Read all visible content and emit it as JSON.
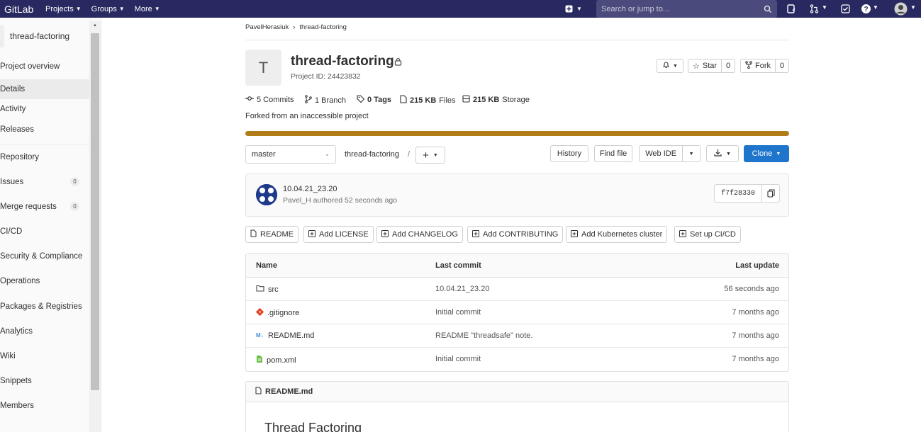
{
  "navbar": {
    "brand": "GitLab",
    "menus": [
      {
        "label": "Projects"
      },
      {
        "label": "Groups"
      },
      {
        "label": "More"
      }
    ],
    "search_placeholder": "Search or jump to..."
  },
  "sidebar": {
    "project_name": "thread-factoring",
    "items": [
      {
        "label": "Project overview"
      },
      {
        "label": "Details"
      },
      {
        "label": "Activity"
      },
      {
        "label": "Releases"
      },
      {
        "label": "Repository"
      },
      {
        "label": "Issues",
        "badge": "0"
      },
      {
        "label": "Merge requests",
        "badge": "0"
      },
      {
        "label": "CI/CD"
      },
      {
        "label": "Security & Compliance"
      },
      {
        "label": "Operations"
      },
      {
        "label": "Packages & Registries"
      },
      {
        "label": "Analytics"
      },
      {
        "label": "Wiki"
      },
      {
        "label": "Snippets"
      },
      {
        "label": "Members"
      }
    ]
  },
  "breadcrumb": {
    "owner": "PavelHerasiuk",
    "sep": "›",
    "project": "thread-factoring"
  },
  "project": {
    "avatar_letter": "T",
    "title": "thread-factoring",
    "id_text": "Project ID: 24423832",
    "star_label": "Star",
    "star_count": "0",
    "fork_label": "Fork",
    "fork_count": "0"
  },
  "stats": {
    "commits": "5 Commits",
    "branches": "1 Branch",
    "tags": "0 Tags",
    "files_size": "215 KB",
    "files_label": "Files",
    "storage_size": "215 KB",
    "storage_label": "Storage"
  },
  "forked_text": "Forked from an inaccessible project",
  "repo_bar": {
    "branch": "master",
    "path": "thread-factoring",
    "path_sep": "/",
    "history": "History",
    "find_file": "Find file",
    "web_ide": "Web IDE",
    "clone": "Clone"
  },
  "commit": {
    "title": "10.04.21_23.20",
    "meta": "Pavel_H authored 52 seconds ago",
    "sha": "f7f28330"
  },
  "quick_actions": [
    "README",
    "Add LICENSE",
    "Add CHANGELOG",
    "Add CONTRIBUTING",
    "Add Kubernetes cluster",
    "Set up CI/CD"
  ],
  "tree": {
    "headers": {
      "name": "Name",
      "last_commit": "Last commit",
      "last_update": "Last update"
    },
    "rows": [
      {
        "name": "src",
        "icon": "folder-icon",
        "commit": "10.04.21_23.20",
        "date": "56 seconds ago"
      },
      {
        "name": ".gitignore",
        "icon": "git-file-icon",
        "commit": "Initial commit",
        "date": "7 months ago"
      },
      {
        "name": "README.md",
        "icon": "markdown-icon",
        "commit": "README \"threadsafe\" note.",
        "date": "7 months ago"
      },
      {
        "name": "pom.xml",
        "icon": "xml-file-icon",
        "commit": "Initial commit",
        "date": "7 months ago"
      }
    ]
  },
  "readme": {
    "filename": "README.md",
    "heading": "Thread Factoring"
  },
  "colors": {
    "navbar": "#292961",
    "clone_button": "#1f75cb",
    "progress": "#b07d19"
  }
}
